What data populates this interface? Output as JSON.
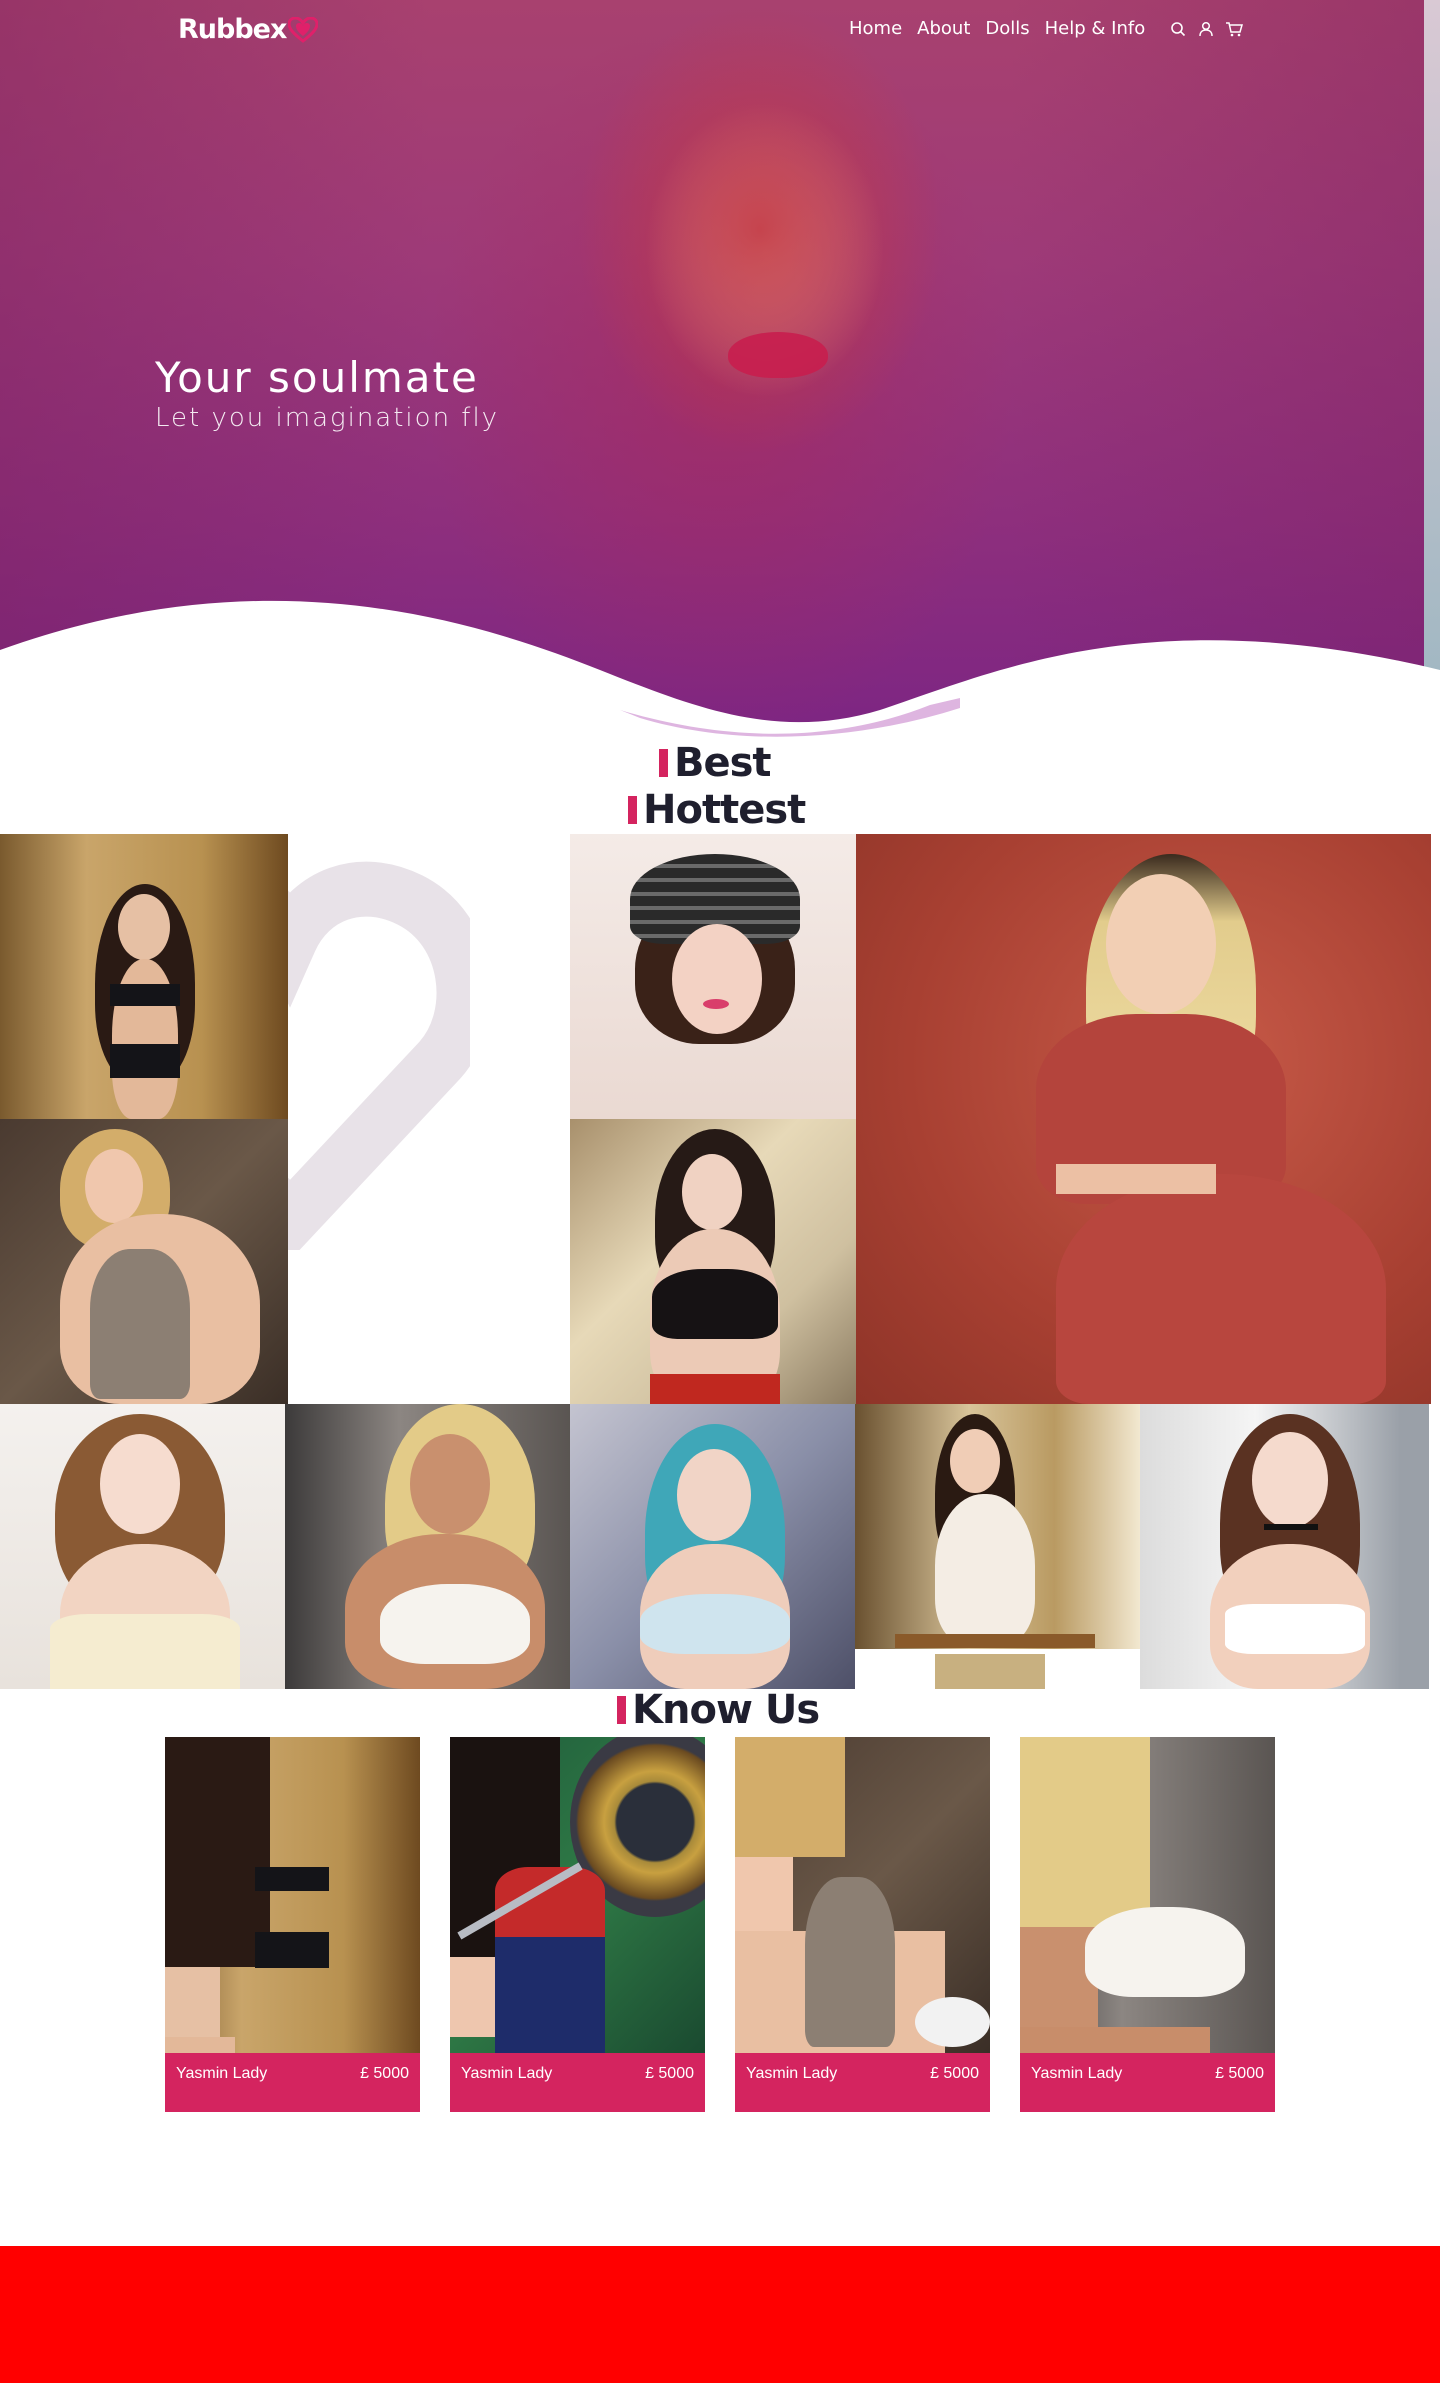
{
  "brand": {
    "name": "Rubbex",
    "accent": "#d4245f",
    "footer_color": "#ff0000"
  },
  "nav": {
    "links": [
      "Home",
      "About",
      "Dolls",
      "Help & Info"
    ],
    "icons": [
      "search-icon",
      "user-icon",
      "cart-icon"
    ]
  },
  "hero": {
    "title": "Your soulmate",
    "subtitle": "Let you imagination fly"
  },
  "sections": {
    "best_hottest": {
      "line1": "Best",
      "line2": "Hottest"
    },
    "know_us": {
      "title": "Know Us"
    }
  },
  "products": [
    {
      "name": "Yasmin Lady",
      "price": "£ 5000"
    },
    {
      "name": "Yasmin Lady",
      "price": "£ 5000"
    },
    {
      "name": "Yasmin Lady",
      "price": "£ 5000"
    },
    {
      "name": "Yasmin Lady",
      "price": "£ 5000"
    }
  ]
}
